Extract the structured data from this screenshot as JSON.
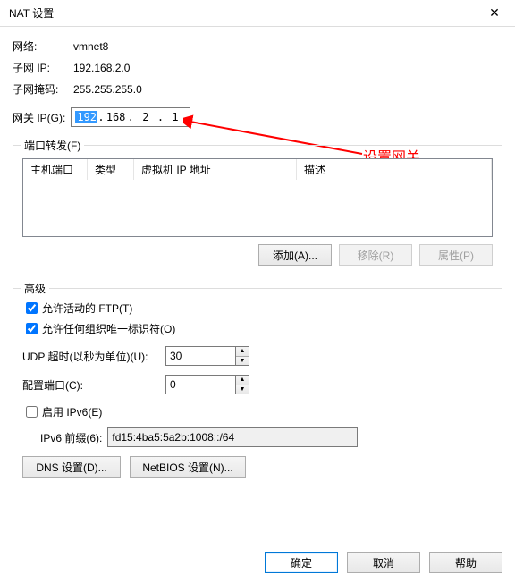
{
  "title": "NAT 设置",
  "info": {
    "network_lbl": "网络:",
    "network_val": "vmnet8",
    "subnet_ip_lbl": "子网 IP:",
    "subnet_ip_val": "192.168.2.0",
    "subnet_mask_lbl": "子网掩码:",
    "subnet_mask_val": "255.255.255.0"
  },
  "gateway": {
    "lbl": "网关 IP(G):",
    "oct1": "192",
    "oct2": "168",
    "oct3": "2",
    "oct4": "1"
  },
  "annotation": "设置网关",
  "portfwd": {
    "legend": "端口转发(F)",
    "col_host": "主机端口",
    "col_type": "类型",
    "col_vmip": "虚拟机 IP 地址",
    "col_desc": "描述"
  },
  "buttons": {
    "add": "添加(A)...",
    "remove": "移除(R)",
    "props": "属性(P)",
    "dns": "DNS 设置(D)...",
    "netbios": "NetBIOS 设置(N)...",
    "ok": "确定",
    "cancel": "取消",
    "help": "帮助"
  },
  "advanced": {
    "legend": "高级",
    "allow_active_ftp": "允许活动的 FTP(T)",
    "allow_any_oui": "允许任何组织唯一标识符(O)",
    "udp_timeout_lbl": "UDP 超时(以秒为单位)(U):",
    "udp_timeout_val": "30",
    "cfg_port_lbl": "配置端口(C):",
    "cfg_port_val": "0",
    "enable_ipv6": "启用 IPv6(E)",
    "ipv6_prefix_lbl": "IPv6 前缀(6):",
    "ipv6_prefix_val": "fd15:4ba5:5a2b:1008::/64"
  }
}
